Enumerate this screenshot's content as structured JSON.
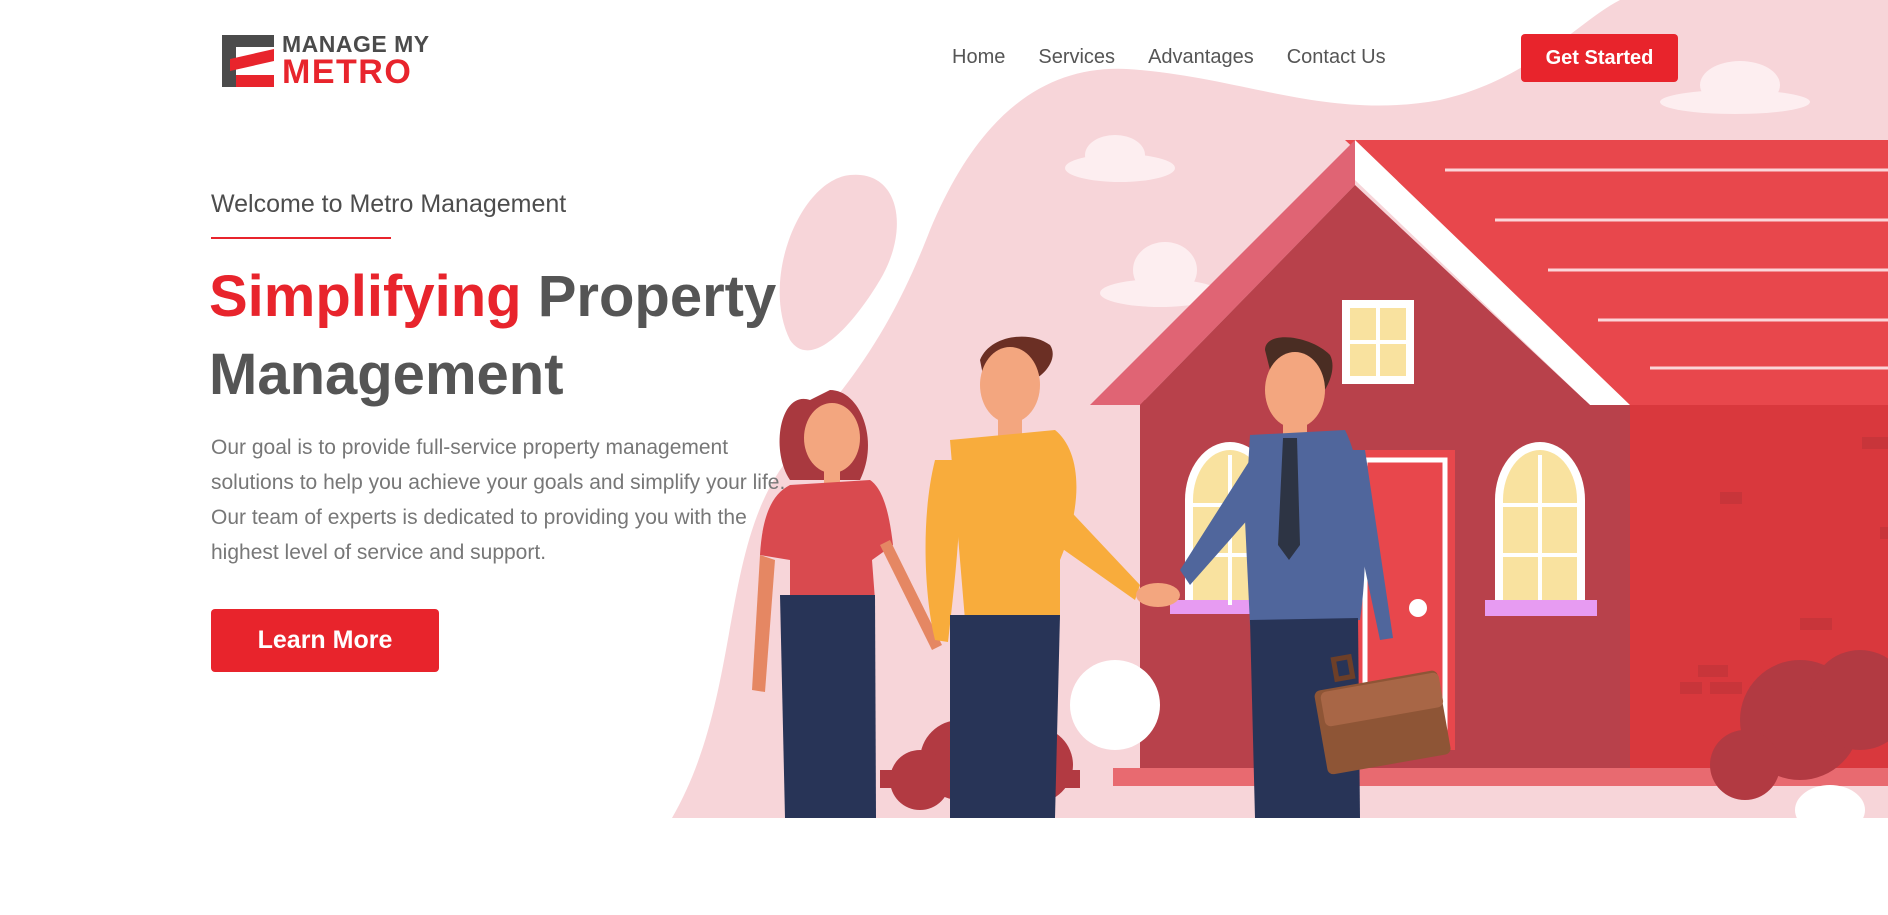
{
  "logo": {
    "line1": "MANAGE MY",
    "line2": "METRO"
  },
  "nav": {
    "items": [
      "Home",
      "Services",
      "Advantages",
      "Contact Us"
    ]
  },
  "header": {
    "cta_label": "Get Started"
  },
  "hero": {
    "eyebrow": "Welcome to Metro Management",
    "headline_accent": "Simplifying",
    "headline_rest1": "Property",
    "headline_rest2": "Management",
    "description": "Our goal is to provide full-service property management solutions to help you achieve your goals and simplify your life. Our team of experts is dedicated to providing you with the highest level of service and support.",
    "button_label": "Learn More"
  },
  "colors": {
    "accent": "#e8242c",
    "text_dark": "#555555",
    "blob": "#f7d5d9",
    "house": "#b8414b"
  }
}
